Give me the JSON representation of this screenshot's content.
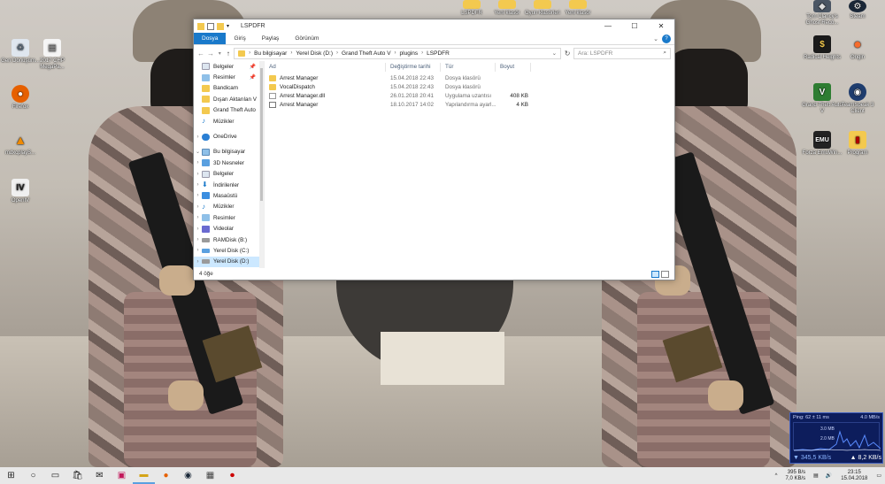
{
  "desktop": {
    "left_icons": [
      {
        "label": "Geri Dönüşüm..."
      },
      {
        "label": "2017 CHP MegaPa..."
      },
      {
        "label": "Firefox"
      },
      {
        "label": "mdxcplayS..."
      },
      {
        "label": "OpenIV"
      }
    ],
    "top_icons": [
      {
        "label": "LSPDFR"
      },
      {
        "label": "Yeni klasör"
      },
      {
        "label": "Oyun klasörleri"
      },
      {
        "label": "Yeni klasör"
      }
    ],
    "right_icons": [
      {
        "label": "Tom Clancy's Ghost Reco..."
      },
      {
        "label": "Steam"
      },
      {
        "label": "Radical Heights"
      },
      {
        "label": "Origin"
      },
      {
        "label": "Grand Theft Auto V"
      },
      {
        "label": "TeamSpeak 3 Client"
      },
      {
        "label": "Forza EmuWin..."
      },
      {
        "label": "Program"
      }
    ]
  },
  "window": {
    "title": "LSPDFR",
    "ribbon_tabs": [
      "Dosya",
      "Giriş",
      "Paylaş",
      "Görünüm"
    ],
    "breadcrumb": [
      "Bu bilgisayar",
      "Yerel Disk (D:)",
      "Grand Theft Auto V",
      "plugins",
      "LSPDFR"
    ],
    "search_placeholder": "Ara: LSPDFR",
    "nav": {
      "quick_access": [
        {
          "label": "Belgeler",
          "pinned": true
        },
        {
          "label": "Resimler",
          "pinned": true
        },
        {
          "label": "Bandicam",
          "pinned": false
        },
        {
          "label": "Dışarı Aktarılan V",
          "pinned": false
        },
        {
          "label": "Grand Theft Auto",
          "pinned": false
        },
        {
          "label": "Müzikler",
          "pinned": false
        }
      ],
      "onedrive": "OneDrive",
      "this_pc": "Bu bilgisayar",
      "pc_items": [
        "3D Nesneler",
        "Belgeler",
        "İndirilenler",
        "Masaüstü",
        "Müzikler",
        "Resimler",
        "Videolar",
        "RAMDisk (B:)",
        "Yerel Disk (C:)",
        "Yerel Disk (D:)"
      ]
    },
    "columns": [
      "Ad",
      "Değiştirme tarihi",
      "Tür",
      "Boyut"
    ],
    "files": [
      {
        "name": "Arrest Manager",
        "date": "15.04.2018 22:43",
        "type": "Dosya klasörü",
        "size": "",
        "icon": "folder"
      },
      {
        "name": "VocalDispatch",
        "date": "15.04.2018 22:43",
        "type": "Dosya klasörü",
        "size": "",
        "icon": "folder"
      },
      {
        "name": "Arrest Manager.dll",
        "date": "26.01.2018 20:41",
        "type": "Uygulama uzantısı",
        "size": "408 KB",
        "icon": "dll"
      },
      {
        "name": "Arrest Manager",
        "date": "18.10.2017 14:02",
        "type": "Yapılandırma ayarl...",
        "size": "4 KB",
        "icon": "cfg"
      }
    ],
    "status": "4 öğe"
  },
  "net_widget": {
    "ping": "Ping: 62 ± 11 ms",
    "max": "4.0 MB/s",
    "scale": "3.0 MB",
    "scale2": "2.0 MB",
    "download": "345,5 KB/s",
    "upload": "8,2 KB/s"
  },
  "taskbar": {
    "net_up": "395 B/s",
    "net_down": "7,0 KB/s",
    "time": "23:15",
    "date": "15.04.2018"
  },
  "colors": {
    "accent": "#1979ca",
    "selection": "#cce8ff",
    "folder": "#f3c94f"
  }
}
